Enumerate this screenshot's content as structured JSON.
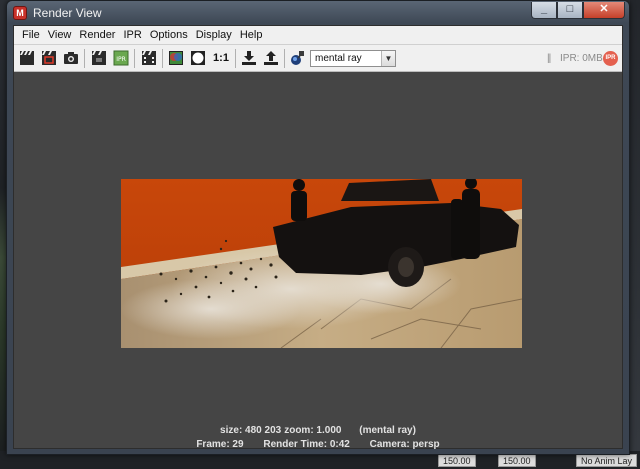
{
  "window": {
    "title": "Render View",
    "icon": "maya-icon",
    "buttons": [
      "minimize",
      "maximize",
      "close"
    ]
  },
  "menu": [
    "File",
    "View",
    "Render",
    "IPR",
    "Options",
    "Display",
    "Help"
  ],
  "toolbar": {
    "icons": [
      "redo-render-icon",
      "render-region-icon",
      "snapshot-icon",
      "ipr-render-icon",
      "ipr-refresh-icon",
      "render-sequence-icon",
      "color-channels-icon",
      "alpha-channel-icon",
      "keep-image-icon",
      "remove-image-icon",
      "render-settings-icon"
    ],
    "ratio_label": "1:1",
    "ipr_small_label": "IPR",
    "renderer_selected": "mental ray",
    "pause_glyph": "||",
    "ipr_memory": "IPR: 0MB",
    "ipr_badge": "IPR"
  },
  "status": {
    "line1": {
      "size": "size:  480  203",
      "zoom": "zoom: 1.000",
      "renderer": "(mental ray)"
    },
    "line2": {
      "frame": "Frame: 29",
      "render_time": "Render Time: 0:42",
      "camera": "Camera: persp"
    }
  },
  "taskbar": [
    "150.00",
    "150.00",
    "No Anim Lay"
  ],
  "colors": {
    "title_bar": "#3e4855",
    "client_bg": "#454545",
    "menu_bg": "#f0f0f0",
    "orange_wall": "#cf4a08",
    "ipr_red": "#e4604f"
  }
}
